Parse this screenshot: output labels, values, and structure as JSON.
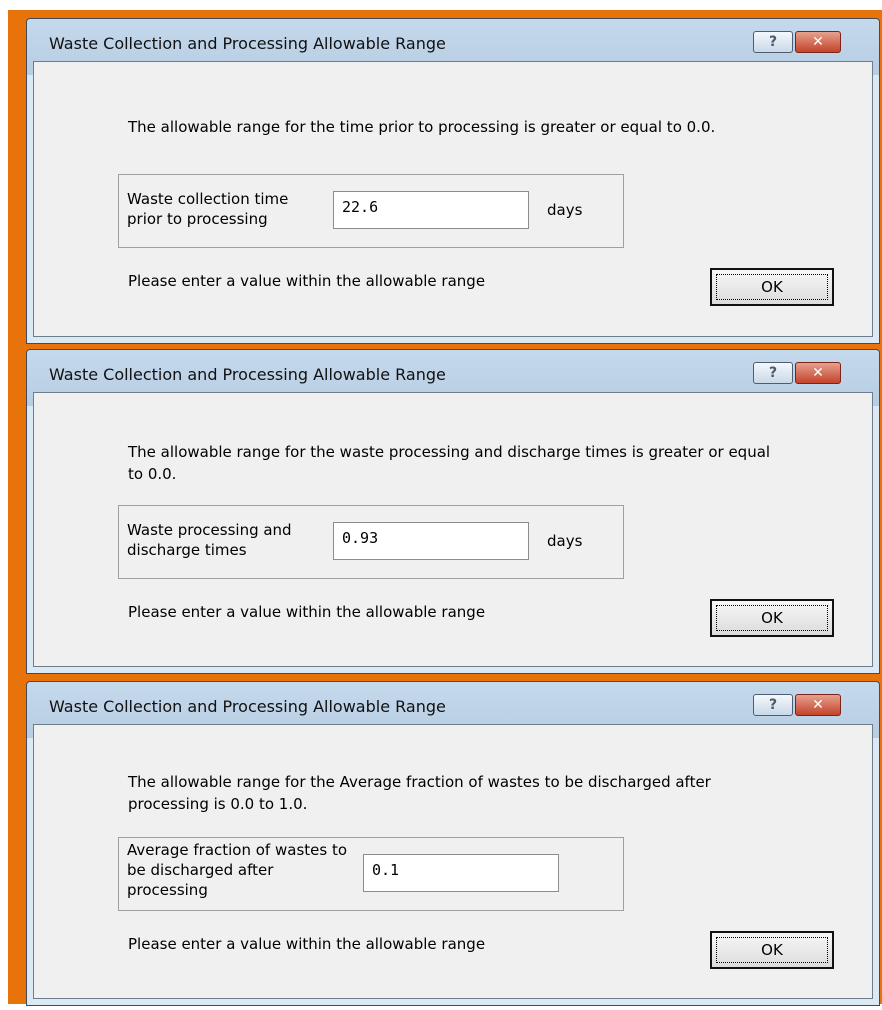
{
  "dialogs": [
    {
      "title": "Waste Collection and Processing Allowable Range",
      "message": "The allowable range for the time prior to processing is greater or equal to 0.0.",
      "field_label": "Waste collection time prior to processing",
      "value": "22.6",
      "units": "days",
      "hint": "Please enter a value within the allowable range",
      "ok_label": "OK"
    },
    {
      "title": "Waste Collection and Processing Allowable Range",
      "message": "The allowable range for the waste processing and discharge times is greater or equal to 0.0.",
      "field_label": "Waste processing and discharge times",
      "value": "0.93",
      "units": "days",
      "hint": "Please enter a value within the allowable range",
      "ok_label": "OK"
    },
    {
      "title": "Waste Collection and Processing Allowable Range",
      "message": "The allowable range for the Average fraction of wastes to be discharged after processing is 0.0 to 1.0.",
      "field_label": "Average fraction of wastes to be discharged after processing",
      "value": "0.1",
      "units": "",
      "hint": "Please enter a value within the allowable range",
      "ok_label": "OK"
    }
  ],
  "icons": {
    "help": "help-icon",
    "close": "close-icon"
  },
  "colors": {
    "frame": "#e8730a",
    "close_button": "#c4432b",
    "titlebar": "#c5d9ec"
  }
}
